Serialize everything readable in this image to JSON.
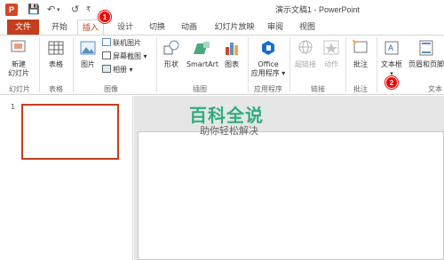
{
  "titlebar": {
    "app_icon_letter": "P",
    "save_glyph": "💾",
    "undo_glyph": "↶",
    "redo_glyph": "↺",
    "customize_glyph": "₹",
    "doc_title": "演示文稿1 - PowerPoint"
  },
  "tabs": {
    "file": "文件",
    "home": "开始",
    "insert": "插入",
    "design": "设计",
    "transitions": "切换",
    "animations": "动画",
    "slideshow": "幻灯片放映",
    "review": "审阅",
    "view": "视图"
  },
  "ribbon": {
    "new_slide": "新建\n幻灯片",
    "table": "表格",
    "picture": "图片",
    "online_picture": "联机图片",
    "screenshot": "屏幕截图",
    "album": "相册",
    "shapes": "形状",
    "smartart": "SmartArt",
    "chart": "图表",
    "office_apps_line1": "Office",
    "office_apps_line2": "应用程序",
    "hyperlink": "超链接",
    "action": "动作",
    "comment": "批注",
    "textbox": "文本框",
    "header_footer": "页眉和页脚",
    "groups": {
      "slides": "幻灯片",
      "tables": "表格",
      "images": "图像",
      "illustrations": "插图",
      "apps": "应用程序",
      "links": "链接",
      "comments": "批注",
      "text": "文本"
    }
  },
  "annotations": {
    "badge1": "1",
    "badge2": "2"
  },
  "workspace": {
    "slide_number": "1"
  },
  "watermark": {
    "main": "百科全说",
    "sub": "助你轻松解决"
  }
}
